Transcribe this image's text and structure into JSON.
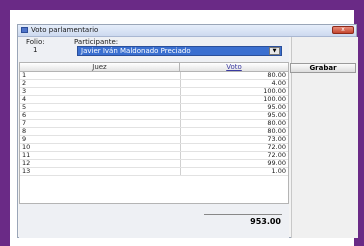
{
  "window": {
    "title": "Voto parlamentario",
    "close_label": "x"
  },
  "header": {
    "folio_label": "Folio:",
    "folio_value": "1",
    "participante_label": "Participante:",
    "participante_value": "Javier Iván Maldonado Preciado"
  },
  "buttons": {
    "grabar": "Grabar"
  },
  "grid": {
    "columns": [
      "Juez",
      "Voto"
    ],
    "rows": [
      {
        "juez": "1",
        "voto": "80.00"
      },
      {
        "juez": "2",
        "voto": "4.00"
      },
      {
        "juez": "3",
        "voto": "100.00"
      },
      {
        "juez": "4",
        "voto": "100.00"
      },
      {
        "juez": "5",
        "voto": "95.00"
      },
      {
        "juez": "6",
        "voto": "95.00"
      },
      {
        "juez": "7",
        "voto": "80.00"
      },
      {
        "juez": "8",
        "voto": "80.00"
      },
      {
        "juez": "9",
        "voto": "73.00"
      },
      {
        "juez": "10",
        "voto": "72.00"
      },
      {
        "juez": "11",
        "voto": "72.00"
      },
      {
        "juez": "12",
        "voto": "99.00"
      },
      {
        "juez": "13",
        "voto": "1.00"
      }
    ],
    "total": "953.00"
  }
}
